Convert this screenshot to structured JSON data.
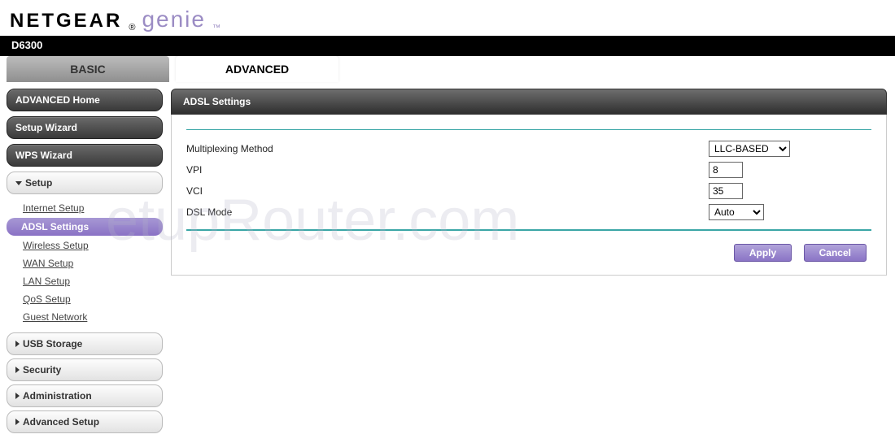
{
  "brand": {
    "name": "NETGEAR",
    "subbrand": "genie"
  },
  "model": "D6300",
  "tabs": {
    "basic": "BASIC",
    "advanced": "ADVANCED"
  },
  "sidebar": {
    "pills": [
      {
        "label": "ADVANCED Home"
      },
      {
        "label": "Setup Wizard"
      },
      {
        "label": "WPS Wizard"
      }
    ],
    "setup": {
      "label": "Setup",
      "items": [
        "Internet Setup",
        "ADSL Settings",
        "Wireless Setup",
        "WAN Setup",
        "LAN Setup",
        "QoS Setup",
        "Guest Network"
      ],
      "active": 1
    },
    "accordions": [
      "USB Storage",
      "Security",
      "Administration",
      "Advanced Setup"
    ]
  },
  "panel": {
    "title": "ADSL Settings",
    "rows": {
      "multiplexing": {
        "label": "Multiplexing Method",
        "value": "LLC-BASED"
      },
      "vpi": {
        "label": "VPI",
        "value": "8"
      },
      "vci": {
        "label": "VCI",
        "value": "35"
      },
      "dsl": {
        "label": "DSL Mode",
        "value": "Auto"
      }
    },
    "buttons": {
      "apply": "Apply",
      "cancel": "Cancel"
    }
  },
  "watermark": "etupRouter.com"
}
